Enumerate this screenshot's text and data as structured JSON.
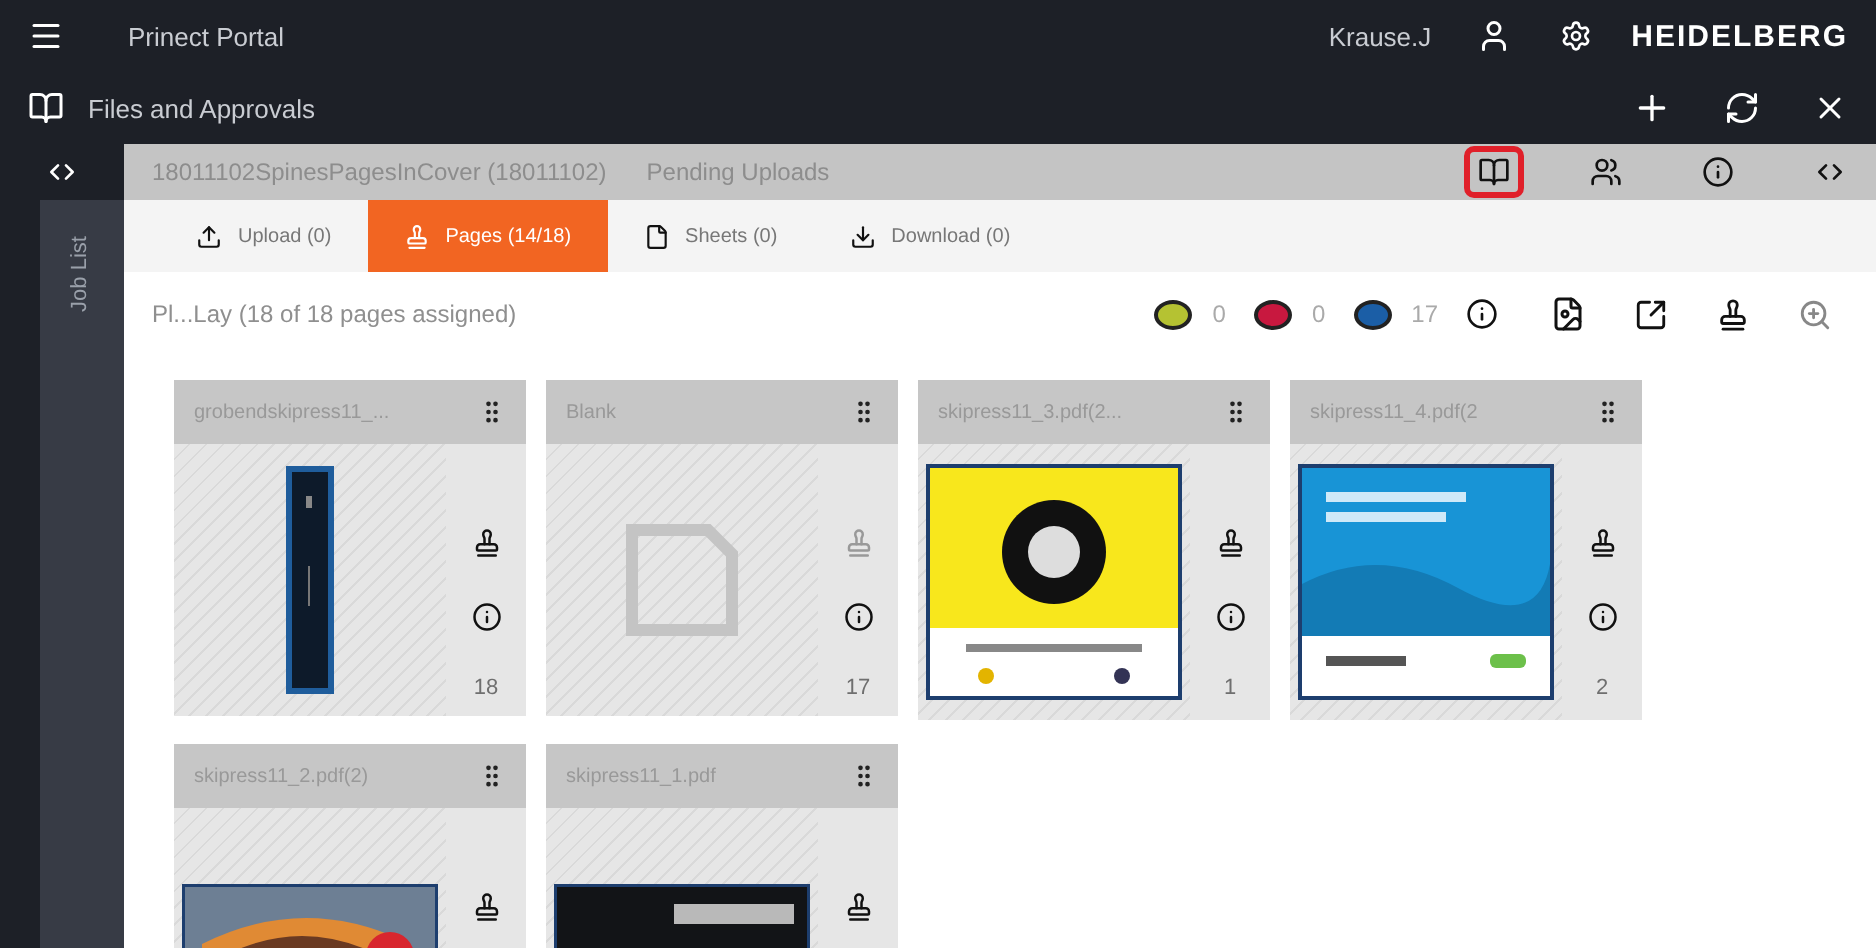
{
  "app": {
    "title": "Prinect Portal",
    "user": "Krause.J",
    "logo": "HEIDELBERG"
  },
  "module": {
    "title": "Files and Approvals"
  },
  "sidebar": {
    "label": "Job List"
  },
  "job": {
    "title": "18011102SpinesPagesInCover (18011102)",
    "status": "Pending Uploads",
    "tools": [
      {
        "kind": "book",
        "highlighted": true
      },
      {
        "kind": "users",
        "highlighted": false
      },
      {
        "kind": "info",
        "highlighted": false
      },
      {
        "kind": "split",
        "highlighted": false
      }
    ]
  },
  "tabs": [
    {
      "label": "Upload (0)",
      "kind": "upload",
      "selected": false
    },
    {
      "label": "Pages (14/18)",
      "kind": "person",
      "selected": true
    },
    {
      "label": "Sheets (0)",
      "kind": "sheet",
      "selected": false
    },
    {
      "label": "Download (0)",
      "kind": "download",
      "selected": false
    }
  ],
  "summary": {
    "text": "Pl...Lay (18 of 18 pages assigned)",
    "counters": [
      {
        "color": "#b5c232",
        "count": "0"
      },
      {
        "color": "#c8183f",
        "count": "0"
      },
      {
        "color": "#1b5ea6",
        "count": "17"
      }
    ]
  },
  "pages": [
    {
      "name": "grobendskipress11_...",
      "kind": "spine",
      "number": "18"
    },
    {
      "name": "Blank",
      "kind": "blank",
      "number": "17"
    },
    {
      "name": "skipress11_3.pdf(2...",
      "kind": "yellow",
      "number": "1"
    },
    {
      "name": "skipress11_4.pdf(2",
      "kind": "blue",
      "number": "2"
    },
    {
      "name": "skipress11_2.pdf(2)",
      "kind": "car"
    },
    {
      "name": "skipress11_1.pdf",
      "kind": "dark"
    }
  ]
}
